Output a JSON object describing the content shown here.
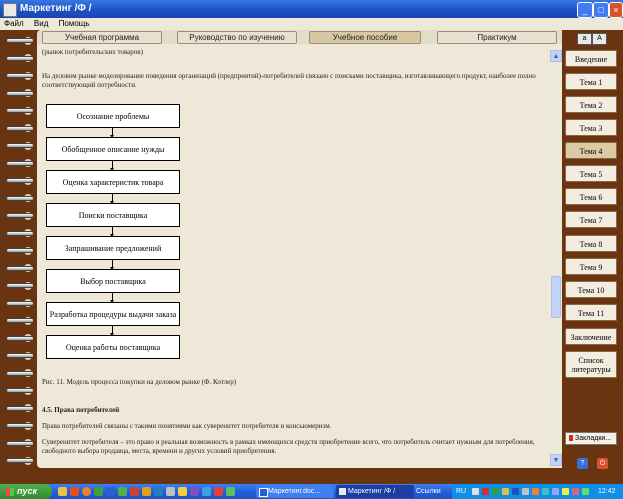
{
  "window": {
    "title": "Маркетинг /Ф /"
  },
  "menu": [
    "Файл",
    "Вид",
    "Помощь"
  ],
  "top_tabs": [
    {
      "label": "Учебная программа",
      "active": false
    },
    {
      "label": "Руководство по изучению",
      "active": false
    },
    {
      "label": "Учебное пособие",
      "active": true
    },
    {
      "label": "Практикум",
      "active": false
    }
  ],
  "font_buttons": {
    "small": "a",
    "large": "A"
  },
  "themes": [
    {
      "label": "Введение",
      "active": false
    },
    {
      "label": "Тема 1",
      "active": false
    },
    {
      "label": "Тема 2",
      "active": false
    },
    {
      "label": "Тема 3",
      "active": false
    },
    {
      "label": "Тема 4",
      "active": true
    },
    {
      "label": "Тема 5",
      "active": false
    },
    {
      "label": "Тема 6",
      "active": false
    },
    {
      "label": "Тема 7",
      "active": false
    },
    {
      "label": "Тема 8",
      "active": false
    },
    {
      "label": "Тема 9",
      "active": false
    },
    {
      "label": "Тема 10",
      "active": false
    },
    {
      "label": "Тема 11",
      "active": false
    },
    {
      "label": "Заключение",
      "active": false
    },
    {
      "label": "Список литературы",
      "active": false
    }
  ],
  "bookmarks_label": "Закладки...",
  "content": {
    "cut_line": "(рынок потребительских товаров)",
    "intro": "На деловом рынке моделирование поведения организаций (предприятий)-потребителей связано с поисками поставщика, изготавливающего продукт, наиболее полно соответствующий потребности.",
    "flow_steps": [
      "Осознание проблемы",
      "Обобщенное описание нужды",
      "Оценка характеристик товара",
      "Поиски поставщика",
      "Запрашивание предложений",
      "Выбор поставщика",
      "Разработка процедуры выдачи заказа",
      "Оценка работы поставщика"
    ],
    "figure_caption": "Рис. 11. Модель процесса покупки на деловом рынке (Ф. Котлер)",
    "section_heading": "4.5. Права потребителей",
    "para1": "Права потребителей связаны с такими понятиями как суверенитет потребителя и консьюмеризм.",
    "para2": "Суверенитет потребителя – это право и реальная возможность в рамках имеющихся средств приобретение всего, что потребитель считает нужным для потребления, свободного выбора продавца, места, времени и других условий приобретения."
  },
  "taskbar": {
    "start_label": "пуск",
    "tasks": [
      {
        "label": "Маркетинг.doc...",
        "active": false
      },
      {
        "label": "Маркетинг /Ф /",
        "active": true
      }
    ],
    "links_label": "Ссылки",
    "language": "RU",
    "clock": "12:42"
  },
  "colors": {
    "frame": "#6b3410",
    "paper": "#efe8d8",
    "active_tab": "#d8c7a3",
    "active_theme": "#dccaa4",
    "xp_blue": "#245edb",
    "start_green": "#3c9a3c"
  }
}
